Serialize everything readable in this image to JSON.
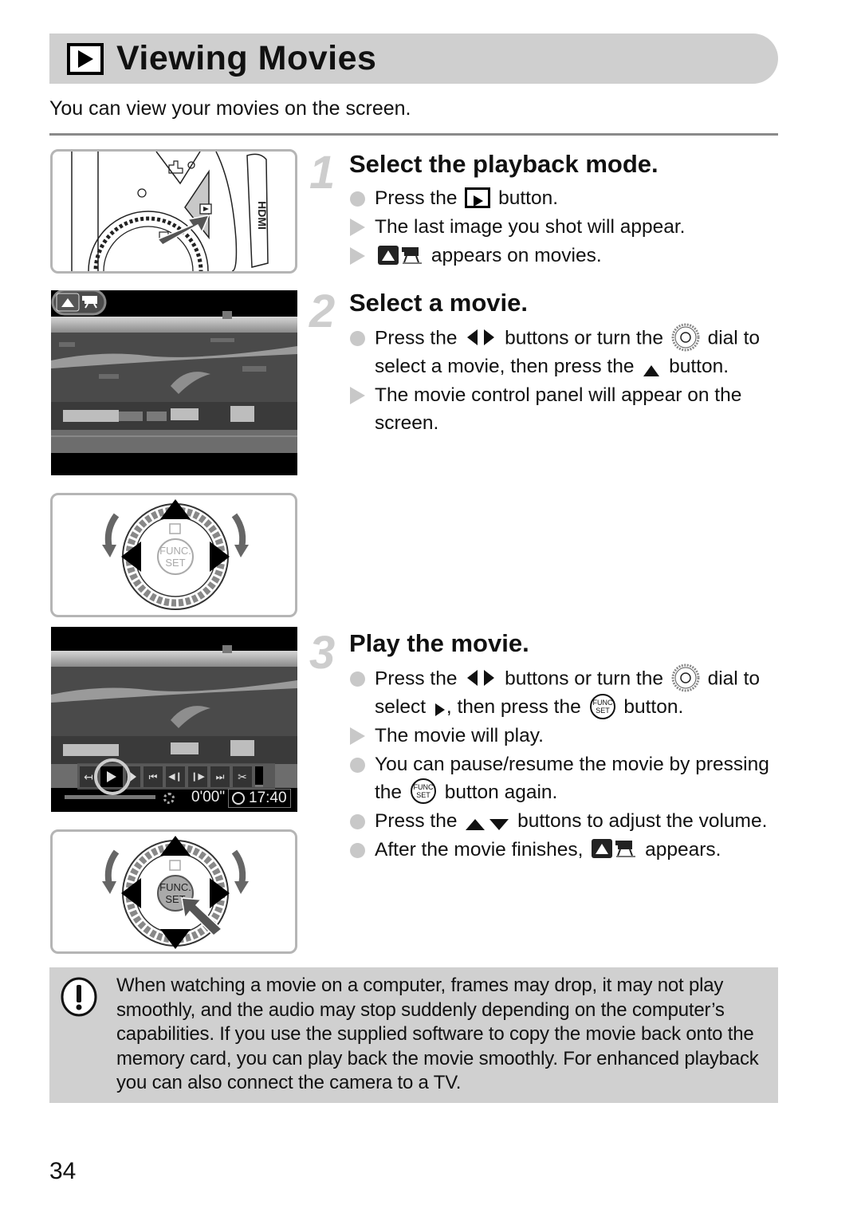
{
  "header": {
    "icon": "playback-icon",
    "title": "Viewing Movies",
    "intro": "You can view your movies on the screen."
  },
  "steps": [
    {
      "number": "1",
      "title": "Select the playback mode.",
      "bullets": [
        {
          "type": "action",
          "parts": [
            "Press the",
            "playback-button-icon",
            "button."
          ]
        },
        {
          "type": "result",
          "parts": [
            "The last image you shot will appear."
          ]
        },
        {
          "type": "result",
          "parts": [
            "movie-up-icon",
            "appears on movies."
          ]
        }
      ]
    },
    {
      "number": "2",
      "title": "Select a movie.",
      "bullets": [
        {
          "type": "action",
          "parts": [
            "Press the",
            "left-right-arrows-icon",
            "buttons or turn the",
            "control-dial-icon",
            "dial to select a movie, then press the",
            "up-arrow-icon",
            "button."
          ]
        },
        {
          "type": "result",
          "parts": [
            "The movie control panel will appear on the screen."
          ]
        }
      ]
    },
    {
      "number": "3",
      "title": "Play the movie.",
      "bullets": [
        {
          "type": "action",
          "parts": [
            "Press the",
            "left-right-arrows-icon",
            "buttons or turn the",
            "control-dial-icon",
            "dial to select",
            "play-icon",
            ", then press the",
            "func-set-icon",
            "button."
          ]
        },
        {
          "type": "result",
          "parts": [
            "The movie will play."
          ]
        },
        {
          "type": "action",
          "parts": [
            "You can pause/resume the movie by pressing the",
            "func-set-icon",
            "button again."
          ]
        },
        {
          "type": "action",
          "parts": [
            "Press the",
            "up-down-arrows-icon",
            "buttons to adjust the volume."
          ]
        },
        {
          "type": "action",
          "parts": [
            "After the movie finishes,",
            "movie-up-icon",
            "appears."
          ]
        }
      ]
    }
  ],
  "text": {
    "s1_b1_a": "Press the",
    "s1_b1_b": "button.",
    "s1_b2": "The last image you shot will appear.",
    "s1_b3": "appears on movies.",
    "s2_b1_a": "Press the",
    "s2_b1_b": "buttons or turn the",
    "s2_b1_c": "dial",
    "s2_b1_d": "to select a movie, then press the",
    "s2_b1_e": "button.",
    "s2_b2": "The movie control panel will appear on the screen.",
    "s3_b1_a": "Press the",
    "s3_b1_b": "buttons or turn the",
    "s3_b1_c": "dial",
    "s3_b1_d": "to select",
    "s3_b1_e": ", then press the",
    "s3_b1_f": "button.",
    "s3_b2": "The movie will play.",
    "s3_b3_a": "You can pause/resume the movie by pressing the",
    "s3_b3_b": "button again.",
    "s3_b4_a": "Press the",
    "s3_b4_b": "buttons to adjust the volume.",
    "s3_b5_a": "After the movie finishes,",
    "s3_b5_b": "appears."
  },
  "illustrations": {
    "camera_hdmi_label": "HDMI",
    "dial_func": "FUNC.",
    "dial_set": "SET",
    "player": {
      "elapsed": "0'00\"",
      "clock": "17:40",
      "progress": 0,
      "controls": [
        "exit",
        "play",
        "slow-motion",
        "first-frame",
        "previous-frame",
        "next-frame",
        "last-frame",
        "edit",
        "volume"
      ],
      "selected_control": "play"
    }
  },
  "caution": {
    "icon": "caution-icon",
    "text": "When watching a movie on a computer, frames may drop, it may not play smoothly, and the audio may stop suddenly depending on the computer’s capabilities. If you use the supplied software to copy the movie back onto the memory card, you can play back the movie smoothly. For enhanced playback you can also connect the camera to a TV."
  },
  "page_number": "34"
}
